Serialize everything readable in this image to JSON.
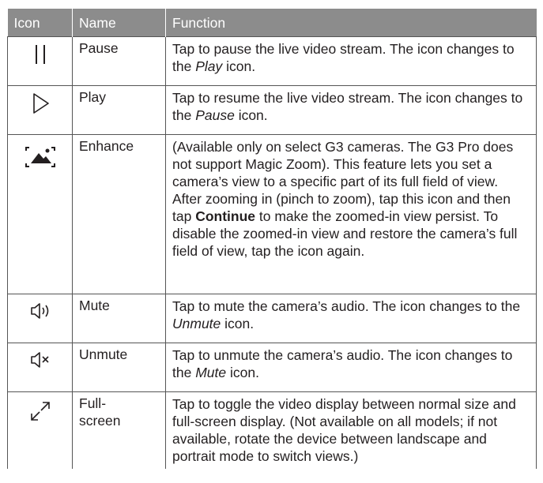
{
  "header": {
    "icon": "Icon",
    "name": "Name",
    "function": "Function"
  },
  "rows": [
    {
      "icon": "pause-icon",
      "name": "Pause",
      "function_parts": [
        "Tap to pause the live video stream. The icon changes to the ",
        "Play",
        " icon."
      ]
    },
    {
      "icon": "play-icon",
      "name": "Play",
      "function_parts": [
        "Tap to resume the live video stream. The icon changes to the ",
        "Pause",
        " icon."
      ]
    },
    {
      "icon": "enhance-icon",
      "name": "Enhance",
      "function_parts": [
        "(Available only on select G3 cameras. The G3 Pro does not support Magic Zoom). This feature lets you set a camera’s view to a specific part of its full field of view. After zooming in (pinch to zoom), tap this icon and then tap ",
        "Continue",
        " to make the zoomed-in view persist. To disable the zoomed-in view and restore the camera’s full field of view, tap the icon again."
      ]
    },
    {
      "icon": "mute-icon",
      "name": "Mute",
      "function_parts": [
        "Tap to mute the camera’s audio. The icon changes to the ",
        "Unmute",
        " icon."
      ]
    },
    {
      "icon": "unmute-icon",
      "name": "Unmute",
      "function_parts": [
        "Tap to unmute the camera’s audio. The icon changes to the ",
        "Mute",
        " icon."
      ]
    },
    {
      "icon": "fullscreen-icon",
      "name": "Full-\nscreen",
      "function_parts": [
        "Tap to toggle the video display between normal size and full-screen display. (Not available on all models; if not available, rotate the device between landscape and portrait mode to switch views.)"
      ]
    }
  ],
  "colors": {
    "header_bg": "#8c8c8c",
    "header_text": "#ffffff",
    "border": "#555555",
    "text": "#231f20"
  }
}
